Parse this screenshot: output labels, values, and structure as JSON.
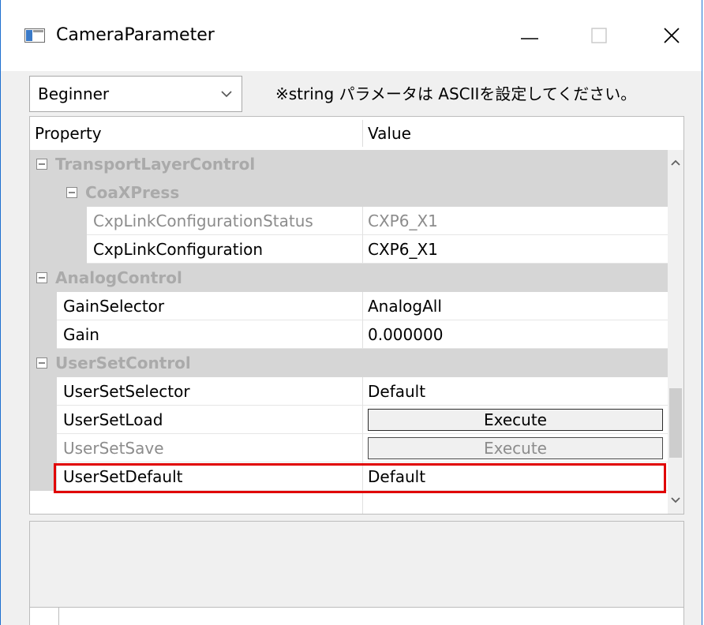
{
  "window": {
    "title": "CameraParameter",
    "icons": {
      "app": "app-window-icon",
      "minimize": "minimize-icon",
      "maximize": "maximize-icon",
      "close": "close-icon"
    }
  },
  "toolbar": {
    "visibility_selected": "Beginner",
    "note": "※string パラメータは ASCIIを設定してください。"
  },
  "grid": {
    "columns": {
      "property": "Property",
      "value": "Value"
    },
    "groups": {
      "transport": "TransportLayerControl",
      "coaxpress": "CoaXPress",
      "analog": "AnalogControl",
      "userset": "UserSetControl"
    },
    "rows": {
      "cxp_status_name": "CxpLinkConfigurationStatus",
      "cxp_status_value": "CXP6_X1",
      "cxp_config_name": "CxpLinkConfiguration",
      "cxp_config_value": "CXP6_X1",
      "gain_selector_name": "GainSelector",
      "gain_selector_value": "AnalogAll",
      "gain_name": "Gain",
      "gain_value": "0.000000",
      "userset_selector_name": "UserSetSelector",
      "userset_selector_value": "Default",
      "userset_load_name": "UserSetLoad",
      "userset_load_button": "Execute",
      "userset_save_name": "UserSetSave",
      "userset_save_button": "Execute",
      "userset_default_name": "UserSetDefault",
      "userset_default_value": "Default"
    }
  },
  "colors": {
    "highlight": "#e00000",
    "group_bg": "#d6d6d6",
    "window_border": "#1e6fd0"
  }
}
